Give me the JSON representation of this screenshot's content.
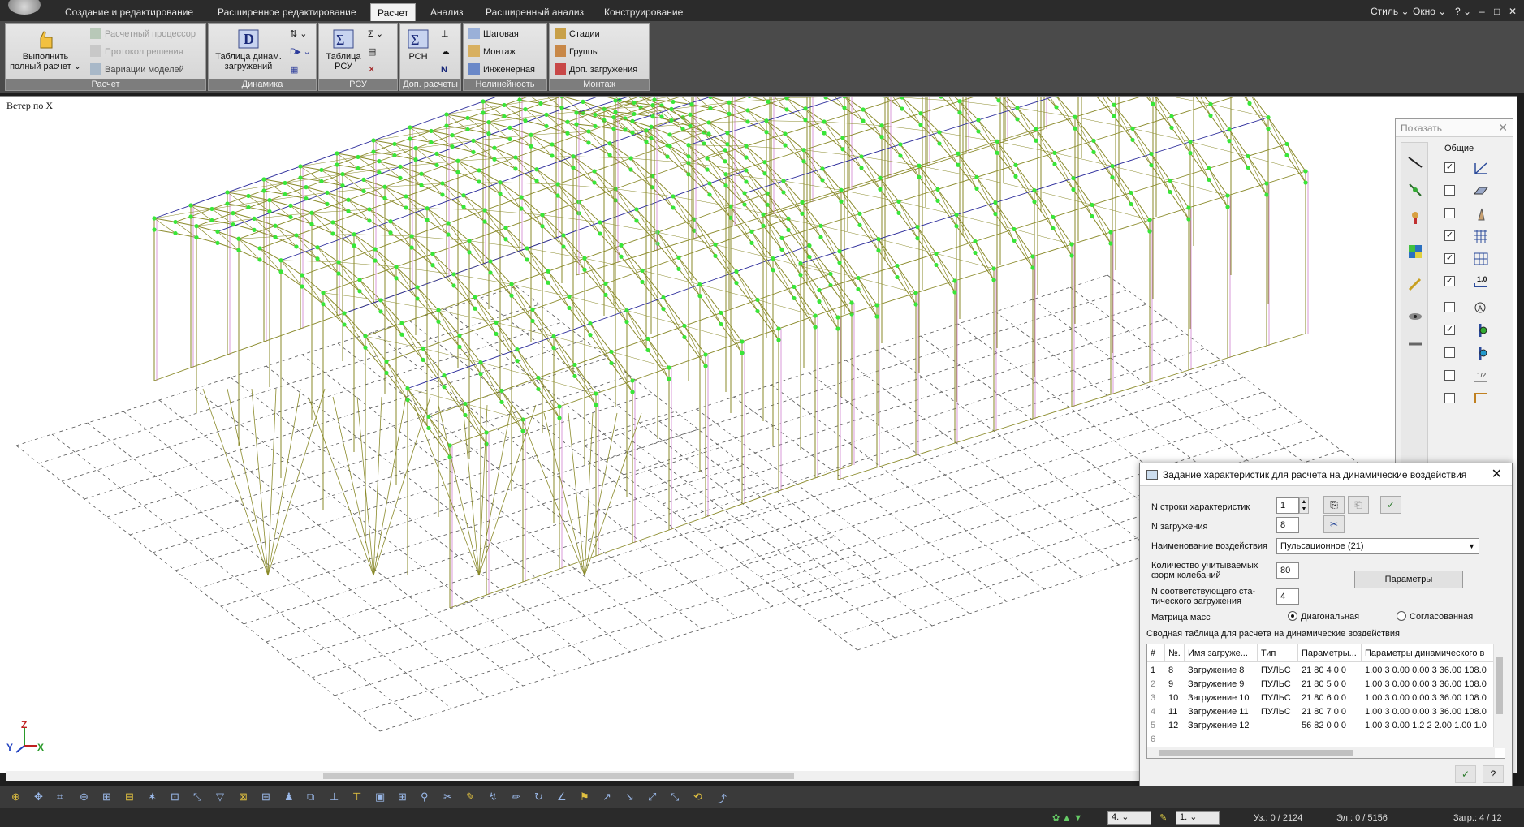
{
  "menu": {
    "tabs": [
      {
        "label": "Создание и редактирование",
        "active": false
      },
      {
        "label": "Расширенное редактирование",
        "active": false
      },
      {
        "label": "Расчет",
        "active": true
      },
      {
        "label": "Анализ",
        "active": false
      },
      {
        "label": "Расширенный анализ",
        "active": false
      },
      {
        "label": "Конструирование",
        "active": false
      }
    ],
    "right": {
      "style": "Стиль",
      "window": "Окно"
    }
  },
  "ribbon": {
    "calc": {
      "run_full": "Выполнить полный расчет",
      "run_full_line1": "Выполнить",
      "run_full_line2": "полный расчет",
      "process": "Расчетный процессор",
      "protocol": "Протокол решения",
      "variations": "Вариации моделей",
      "group": "Расчет"
    },
    "dynamics": {
      "table_line1": "Таблица динам.",
      "table_line2": "загружений",
      "group": "Динамика"
    },
    "rsu": {
      "table_line1": "Таблица",
      "table_line2": "РСУ",
      "group": "РСУ"
    },
    "extra": {
      "rsn": "РСН",
      "group": "Доп. расчеты"
    },
    "nonlinear": {
      "step": "Шаговая",
      "mount": "Монтаж",
      "engineering": "Инженерная",
      "group": "Нелинейность"
    },
    "montage": {
      "stages": "Стадии",
      "groups": "Группы",
      "extra_loads": "Доп. загружения",
      "group": "Монтаж"
    }
  },
  "viewport": {
    "title": "Ветер по X",
    "axes": {
      "x": "X",
      "y": "Y",
      "z": "Z"
    }
  },
  "show_panel": {
    "title": "Показать",
    "section": "Общие",
    "checks": [
      true,
      false,
      false,
      true,
      true,
      true,
      false,
      true,
      false,
      false,
      false
    ]
  },
  "dialog": {
    "title": "Задание характеристик для расчета на динамические воздействия",
    "row_label": "N строки характеристик",
    "row_value": "1",
    "load_label": "N загружения",
    "load_value": "8",
    "action_label": "Наименование воздействия",
    "action_value": "Пульсационное (21)",
    "modes_label_line1": "Количество учитываемых",
    "modes_label_line2": "форм колебаний",
    "modes_value": "80",
    "params_button": "Параметры",
    "static_label_line1": "N соответствующего ста-",
    "static_label_line2": "тического загружения",
    "static_value": "4",
    "mass_label": "Матрица масс",
    "mass_diag": "Диагональная",
    "mass_consistent": "Согласованная",
    "summary_label": "Сводная таблица для расчета на динамические воздействия",
    "table": {
      "columns": [
        "#",
        "№.",
        "Имя загруже...",
        "Тип",
        "Параметры...",
        "Параметры динамического в"
      ],
      "rows": [
        {
          "idx": "1",
          "n": "8",
          "name": "Загружение 8",
          "type": "ПУЛЬС",
          "params": "21  80 4  0 0",
          "dyn": "1.00 3 0.00 0.00 3 36.00 108.0"
        },
        {
          "idx": "2",
          "n": "9",
          "name": "Загружение 9",
          "type": "ПУЛЬС",
          "params": "21  80 5  0 0",
          "dyn": "1.00 3 0.00 0.00 3 36.00 108.0"
        },
        {
          "idx": "3",
          "n": "10",
          "name": "Загружение 10",
          "type": "ПУЛЬС",
          "params": "21  80 6  0 0",
          "dyn": "1.00 3 0.00 0.00 3 36.00 108.0"
        },
        {
          "idx": "4",
          "n": "11",
          "name": "Загружение 11",
          "type": "ПУЛЬС",
          "params": "21  80 7  0 0",
          "dyn": "1.00 3 0.00 0.00 3 36.00 108.0"
        },
        {
          "idx": "5",
          "n": "12",
          "name": "Загружение 12",
          "type": "",
          "params": "56  82 0  0 0",
          "dyn": "1.00 3 0.00 1.2 2 2.00 1.00 1.0"
        },
        {
          "idx": "6",
          "n": "",
          "name": "",
          "type": "",
          "params": "",
          "dyn": ""
        }
      ]
    }
  },
  "status": {
    "combo1": "4.",
    "combo2": "1.",
    "nodes": "Уз.: 0 / 2124",
    "elements": "Эл.: 0 / 5156",
    "loads": "Загр.: 4 / 12"
  },
  "colors": {
    "node": "#39e639",
    "frame": "#8a8a2a",
    "brace": "#2a2a9a",
    "pink": "#d080d0",
    "grid": "#555555"
  }
}
